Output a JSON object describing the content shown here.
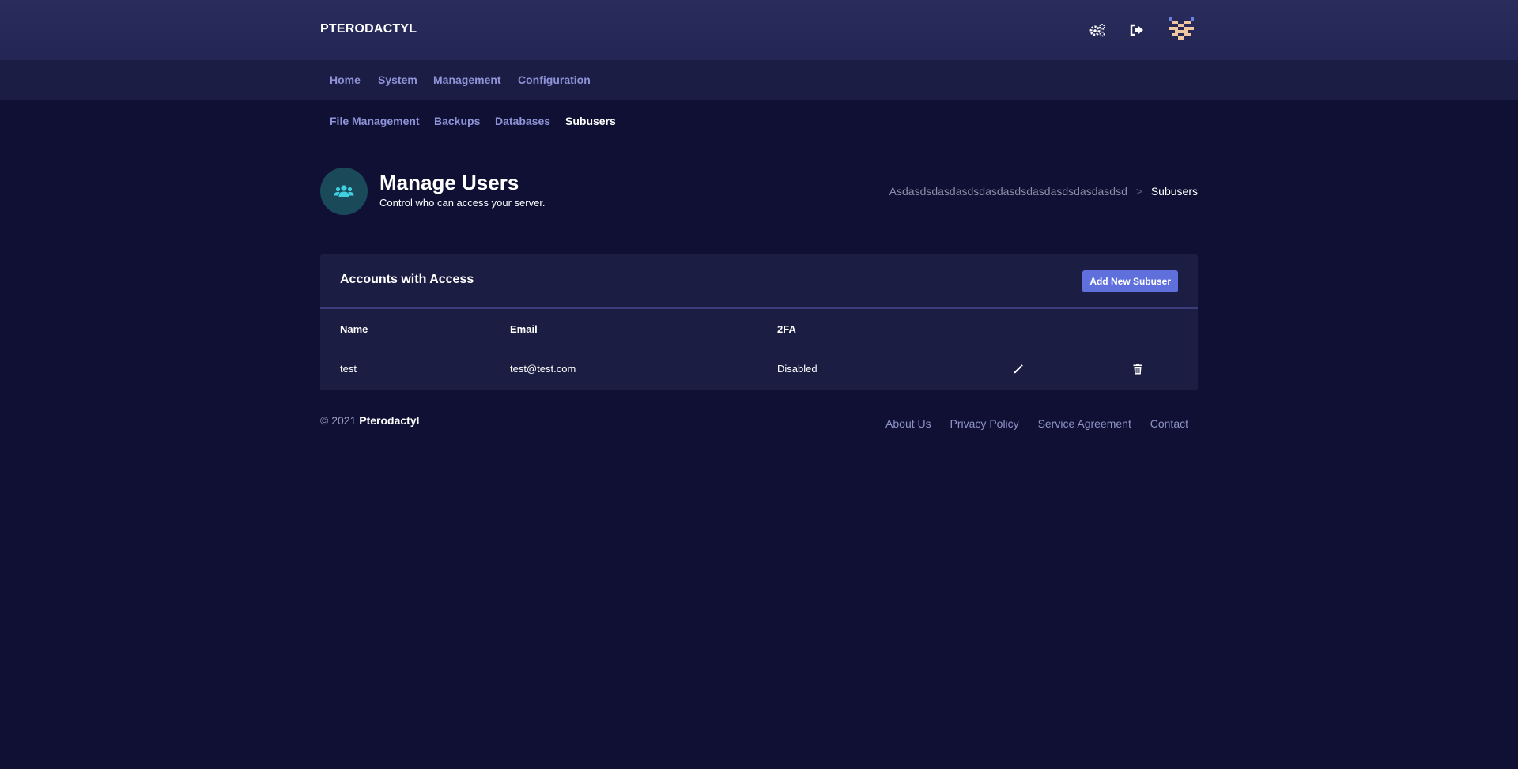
{
  "app": {
    "brand": "PTERODACTYL"
  },
  "topbar": {
    "icons": [
      "admin-cogs-icon",
      "logout-icon"
    ],
    "avatar": "avatar"
  },
  "main_nav": [
    {
      "label": "Home"
    },
    {
      "label": "System"
    },
    {
      "label": "Management"
    },
    {
      "label": "Configuration"
    }
  ],
  "sub_nav": [
    {
      "label": "File Management"
    },
    {
      "label": "Backups"
    },
    {
      "label": "Databases"
    },
    {
      "label": "Subusers",
      "active": true
    }
  ],
  "page": {
    "icon": "users-icon",
    "title": "Manage Users",
    "subtitle": "Control who can access your server."
  },
  "breadcrumb": {
    "server": "Asdasdsdasdasdsdasdasdsdasdasdsdasdasdsd",
    "separator": ">",
    "current": "Subusers"
  },
  "card": {
    "title": "Accounts with Access",
    "add_button": "Add New Subuser",
    "columns": [
      "Name",
      "Email",
      "2FA"
    ],
    "rows": [
      {
        "name": "test",
        "email": "test@test.com",
        "twofa": "Disabled"
      }
    ]
  },
  "footer": {
    "copyright_prefix": "© 2021",
    "copyright_brand": "Pterodactyl",
    "links": [
      "About Us",
      "Privacy Policy",
      "Service Agreement",
      "Contact"
    ]
  },
  "colors": {
    "background": "#0f1033",
    "topbar": "#262958",
    "nav": "#1b1d44",
    "card": "#1c1d42",
    "accent": "#5f6fdc",
    "icon_teal": "#3fd0e0"
  }
}
